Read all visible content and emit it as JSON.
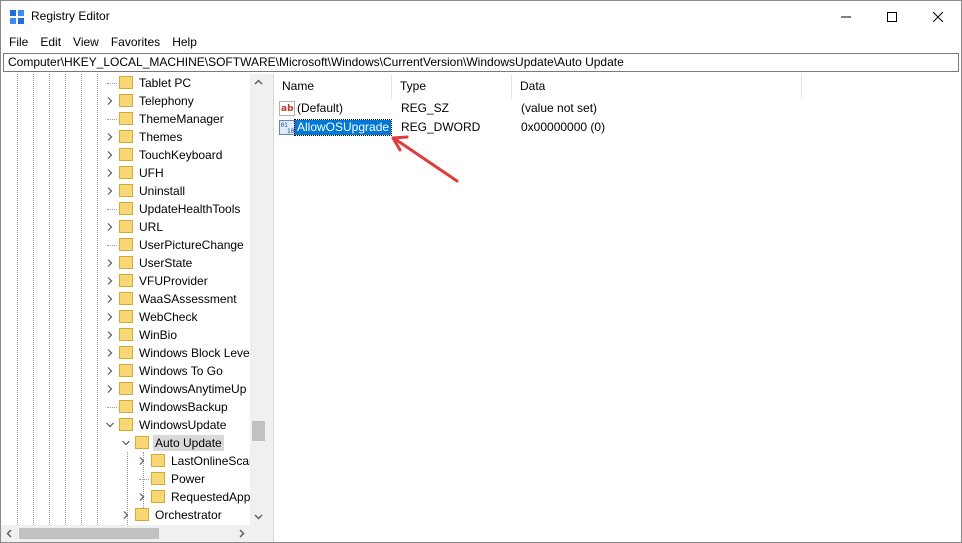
{
  "window": {
    "title": "Registry Editor"
  },
  "menu": [
    "File",
    "Edit",
    "View",
    "Favorites",
    "Help"
  ],
  "address": "Computer\\HKEY_LOCAL_MACHINE\\SOFTWARE\\Microsoft\\Windows\\CurrentVersion\\WindowsUpdate\\Auto Update",
  "tree": {
    "items": [
      "Tablet PC",
      "Telephony",
      "ThemeManager",
      "Themes",
      "TouchKeyboard",
      "UFH",
      "Uninstall",
      "UpdateHealthTools",
      "URL",
      "UserPictureChange",
      "UserState",
      "VFUProvider",
      "WaaSAssessment",
      "WebCheck",
      "WinBio",
      "Windows Block Leve",
      "Windows To Go",
      "WindowsAnytimeUp",
      "WindowsBackup",
      "WindowsUpdate",
      "Auto Update",
      "LastOnlineScar",
      "Power",
      "RequestedApp",
      "Orchestrator"
    ],
    "selected": "Auto Update"
  },
  "values_panel": {
    "columns": [
      "Name",
      "Type",
      "Data"
    ],
    "rows": [
      {
        "name": "(Default)",
        "type": "REG_SZ",
        "data": "(value not set)",
        "icon": "string-value-icon"
      },
      {
        "name": "AllowOSUpgrade",
        "type": "REG_DWORD",
        "data": "0x00000000 (0)",
        "icon": "dword-value-icon",
        "selected": true
      }
    ]
  },
  "colors": {
    "selection": "#0078d7",
    "folder": "#f8d775",
    "annotation_arrow": "#e03c3c"
  }
}
